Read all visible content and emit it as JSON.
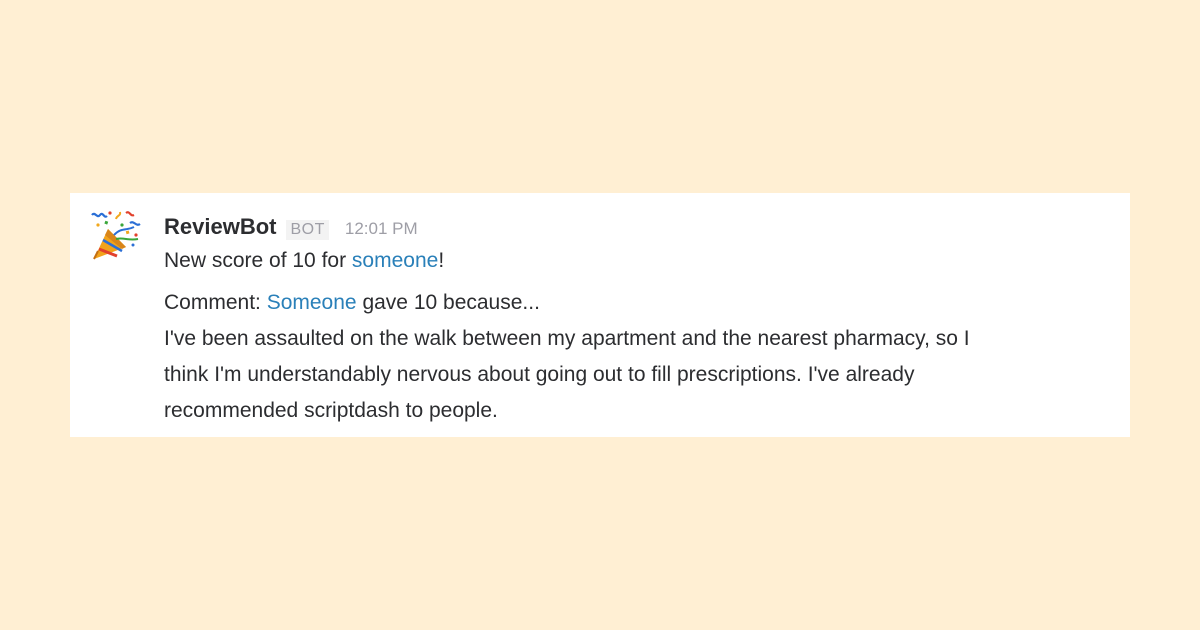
{
  "message": {
    "sender": "ReviewBot",
    "badge": "BOT",
    "timestamp": "12:01 PM",
    "score_line": {
      "prefix": "New score of 10 for ",
      "mention": "someone",
      "suffix": "!"
    },
    "comment_line": {
      "prefix": "Comment: ",
      "mention": "Someone",
      "suffix": " gave 10 because..."
    },
    "body_lines": [
      "I've been assaulted on the walk between my apartment and the nearest pharmacy, so I",
      "think I'm understandably nervous about going out to fill prescriptions. I've already",
      "recommended scriptdash to people."
    ],
    "avatar_icon": "party-popper-icon"
  },
  "colors": {
    "page_background": "#ffefd3",
    "card_background": "#ffffff",
    "text": "#2c2d30",
    "mention": "#2a80b9",
    "muted": "#9e9ea6"
  }
}
